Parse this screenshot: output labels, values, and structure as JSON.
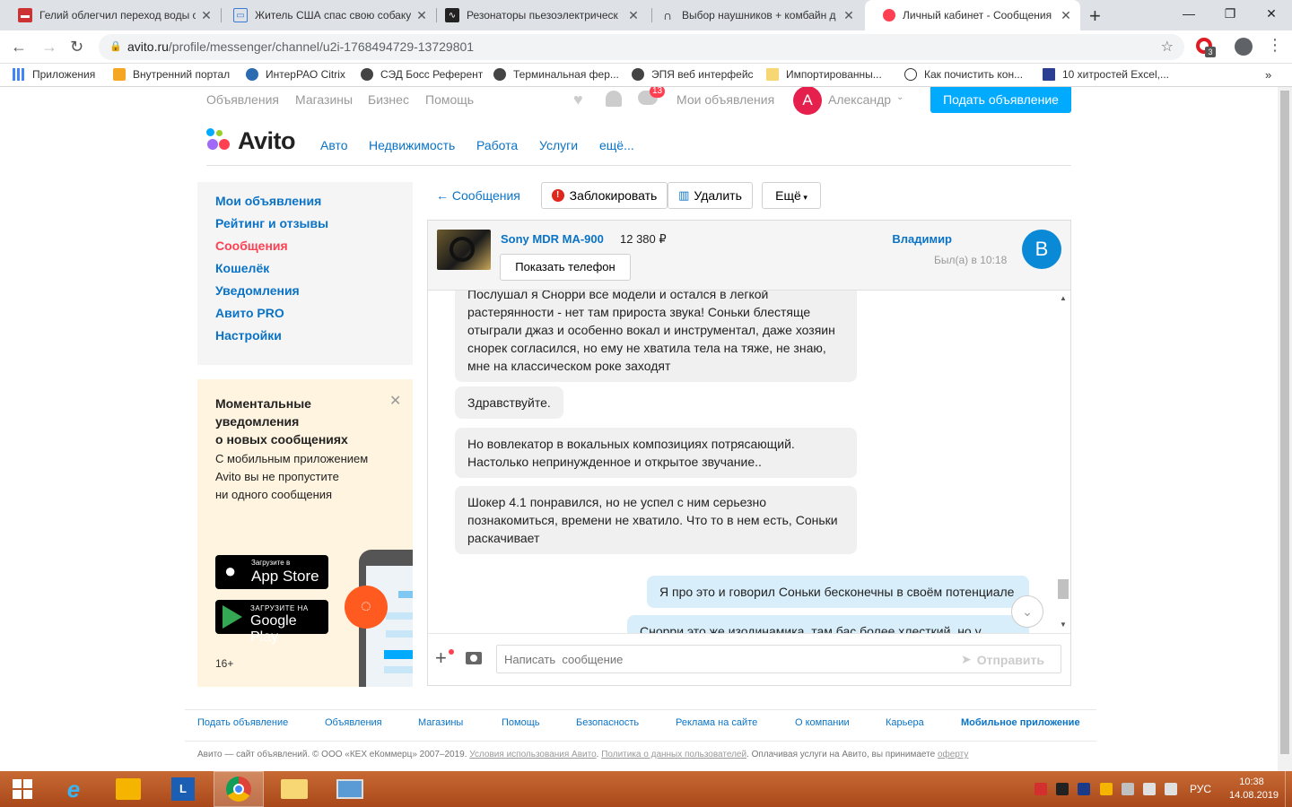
{
  "browser": {
    "tabs": [
      {
        "title": "Гелий облегчил переход воды с",
        "active": false
      },
      {
        "title": "Житель США спас свою собаку",
        "active": false
      },
      {
        "title": "Резонаторы пьезоэлектрическ",
        "active": false
      },
      {
        "title": "Выбор наушников + комбайн д",
        "active": false
      },
      {
        "title": "Личный кабинет - Сообщения",
        "active": true
      }
    ],
    "url_host": "avito.ru",
    "url_path": "/profile/messenger/channel/u2i-1768494729-13729801",
    "profile_badge": "3",
    "bookmarks": [
      "Приложения",
      "Внутренний портал",
      "ИнтерРАО Citrix",
      "СЭД Босс Референт",
      "Терминальная фер...",
      "ЭПЯ веб интерфейс",
      "Импортированны...",
      "Как почистить кон...",
      "10 хитростей Excel,..."
    ]
  },
  "site": {
    "top_links": [
      "Объявления",
      "Магазины",
      "Бизнес",
      "Помощь"
    ],
    "notification_count": "13",
    "my_ads": "Мои объявления",
    "user_initial": "А",
    "user_name": "Александр",
    "post_ad_button": "Подать объявление",
    "logo": "Avito",
    "categories": [
      "Авто",
      "Недвижимость",
      "Работа",
      "Услуги",
      "ещё..."
    ]
  },
  "sidebar": {
    "items": [
      "Мои объявления",
      "Рейтинг и отзывы",
      "Сообщения",
      "Кошелёк",
      "Уведомления",
      "Авито PRO",
      "Настройки"
    ],
    "active_index": 2
  },
  "promo": {
    "title_line1": "Моментальные",
    "title_line2": "уведомления",
    "title_line3": "о новых сообщениях",
    "text_line1": "С мобильным приложением",
    "text_line2": "Avito вы не пропустите",
    "text_line3": "ни одного сообщения",
    "appstore_small": "Загрузите в",
    "appstore_big": "App Store",
    "gplay_small": "ЗАГРУЗИТЕ НА",
    "gplay_big": "Google Play",
    "age": "16+"
  },
  "chat": {
    "back_link": "← Сообщения",
    "block_button": "Заблокировать",
    "delete_button": "Удалить",
    "more_button": "Ещё",
    "item_title": "Sony MDR MA-900",
    "item_price": "12 380 ₽",
    "show_phone": "Показать телефон",
    "contact_name": "Владимир",
    "contact_initial": "В",
    "last_seen": "Был(а) в 10:18",
    "messages": [
      {
        "dir": "in",
        "lines": [
          "Послушал я Снорри все модели и остался в  легкой",
          "растерянности - нет там прироста звука! Соньки блестяще",
          "отыграли джаз и особенно вокал и инструментал, даже хозяин",
          "снорек согласился, но ему не хватила тела на тяже, не знаю,",
          "мне на классическом роке заходят"
        ]
      },
      {
        "dir": "in",
        "lines": [
          "Здравствуйте."
        ]
      },
      {
        "dir": "in",
        "lines": [
          "Но вовлекатор в вокальных композициях потрясающий.",
          "Настолько непринужденное и открытое звучание.."
        ]
      },
      {
        "dir": "in",
        "lines": [
          "Шокер 4.1 понравился, но не успел с ним серьезно",
          "познакомиться, времени не хватило. Что то в нем есть, Соньки",
          "раскачивает"
        ]
      },
      {
        "dir": "out",
        "lines": [
          "Я про это и говорил Соньки бесконечны в своём потенциале"
        ]
      },
      {
        "dir": "out",
        "lines": [
          "Снорри это же изодинамика, там бас более хлесткий, но у"
        ]
      }
    ],
    "input_placeholder": "Написать  сообщение",
    "send_button": "Отправить"
  },
  "footer": {
    "links": [
      "Подать объявление",
      "Объявления",
      "Магазины",
      "Помощь",
      "Безопасность",
      "Реклама на сайте",
      "О компании",
      "Карьера",
      "Мобильное приложение"
    ],
    "copyright": "Авито — сайт объявлений. © ООО «КЕХ еКоммерц» 2007–2019.",
    "terms": "Условия использования Авито",
    "privacy": "Политика о данных пользователей",
    "paid_text": "Оплачивая услуги на Авито, вы принимаете",
    "offer": "оферту"
  },
  "taskbar": {
    "language": "РУС",
    "time": "10:38",
    "date": "14.08.2019"
  },
  "colors": {
    "link_blue": "#0a73c6",
    "active_red": "#ff4053",
    "post_button": "#00aaff",
    "contact_avatar": "#0a8ad6",
    "user_avatar": "#e6204c"
  }
}
